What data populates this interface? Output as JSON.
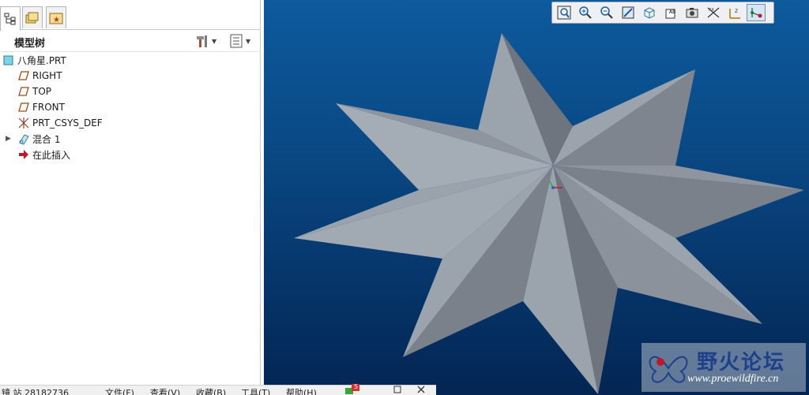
{
  "panel": {
    "title": "模型树"
  },
  "tree": {
    "root": "八角星.PRT",
    "items": [
      {
        "label": "RIGHT",
        "icon": "datum-plane-icon"
      },
      {
        "label": "TOP",
        "icon": "datum-plane-icon"
      },
      {
        "label": "FRONT",
        "icon": "datum-plane-icon"
      },
      {
        "label": "PRT_CSYS_DEF",
        "icon": "csys-icon"
      },
      {
        "label": "混合 1",
        "icon": "blend-feature-icon"
      },
      {
        "label": "在此插入",
        "icon": "insert-here-arrow-icon"
      }
    ]
  },
  "statusbar": {
    "left": "镜  站  28182736",
    "file": "文件(F)",
    "view": "查看(V)",
    "favorites": "收藏(B)",
    "tools": "工具(T)",
    "help": "帮助(H)",
    "badge": "5"
  },
  "watermark": {
    "title": "野火论坛",
    "url": "www.proewildfire.cn"
  },
  "colors": {
    "viewport_top": "#0d5a9d",
    "viewport_bottom": "#032553",
    "star_light": "#9ba3ad",
    "star_dark": "#6e757e"
  }
}
